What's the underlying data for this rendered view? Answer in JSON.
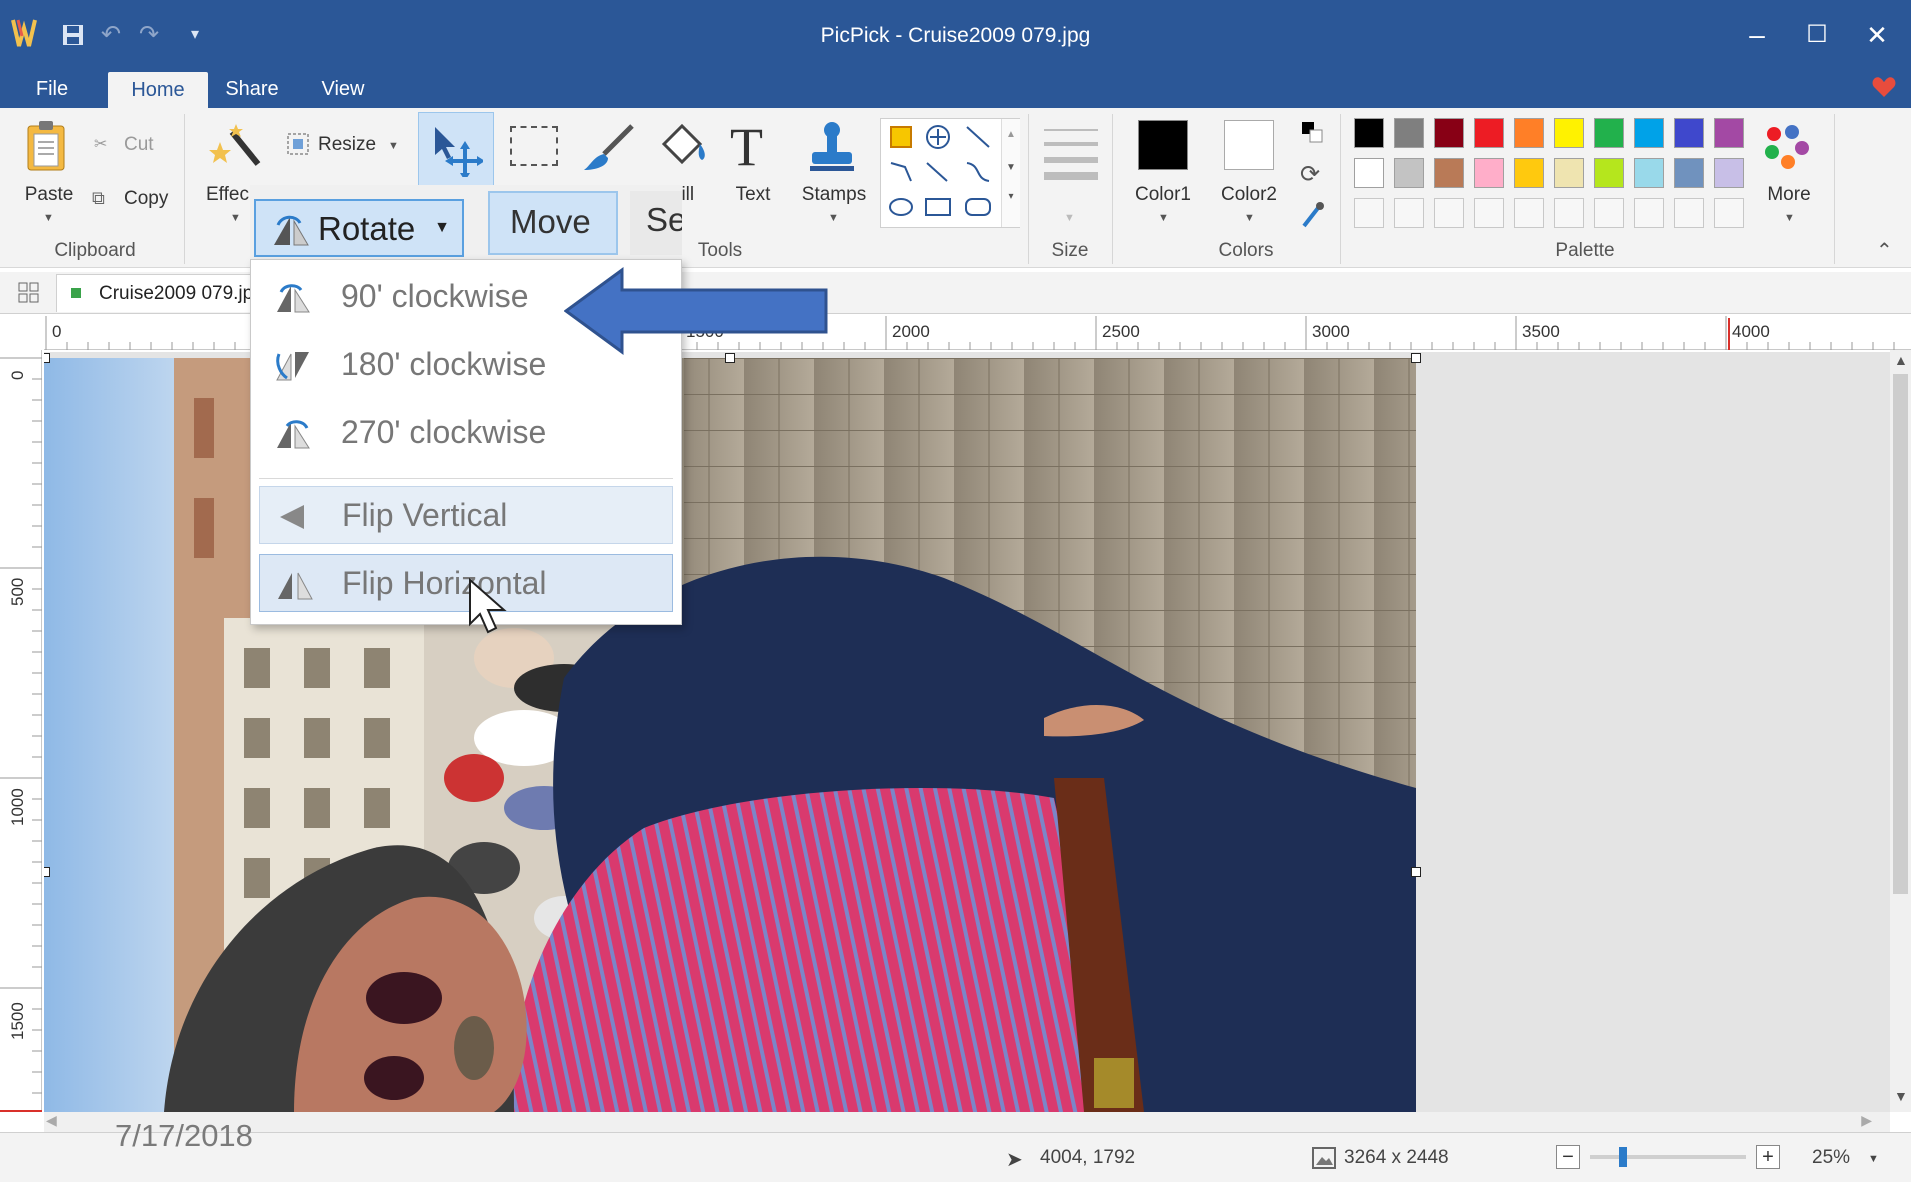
{
  "window": {
    "title": "PicPick - Cruise2009 079.jpg",
    "minimize_label": "–",
    "maximize_label": "☐",
    "close_label": "✕"
  },
  "menu_tabs": {
    "file": "File",
    "home": "Home",
    "share": "Share",
    "view": "View"
  },
  "ribbon": {
    "clipboard": {
      "paste": "Paste",
      "cut": "Cut",
      "copy": "Copy",
      "group_label": "Clipboard"
    },
    "image": {
      "effects": "Effec",
      "resize": "Resize"
    },
    "tools": {
      "fill": "Fill",
      "text": "Text",
      "stamps": "Stamps",
      "group_label": "Tools"
    },
    "size": {
      "group_label": "Size"
    },
    "colors": {
      "color1": "Color1",
      "color2": "Color2",
      "group_label": "Colors",
      "color1_value": "#000000",
      "color2_value": "#ffffff"
    },
    "palette": {
      "group_label": "Palette",
      "more": "More",
      "row1": [
        "#000000",
        "#7f7f7f",
        "#880015",
        "#ed1c24",
        "#ff7f27",
        "#fff200",
        "#22b14c",
        "#00a2e8",
        "#3f48cc",
        "#a349a4"
      ],
      "row2": [
        "#ffffff",
        "#c3c3c3",
        "#b97a57",
        "#ffaec9",
        "#ffc90e",
        "#efe4b0",
        "#b5e61d",
        "#99d9ea",
        "#7092be",
        "#c8bfe7"
      ]
    }
  },
  "document": {
    "tab_name": "Cruise2009 079.jp"
  },
  "ruler": {
    "h_labels": [
      "0",
      "1500",
      "2000",
      "2500",
      "3000",
      "3500",
      "4000"
    ],
    "v_labels": [
      "0",
      "500",
      "1000",
      "1500"
    ]
  },
  "dropdown": {
    "rotate_label": "Rotate",
    "move_label": "Move",
    "select_label": "Sel",
    "items": [
      "90' clockwise",
      "180' clockwise",
      "270' clockwise",
      "Flip Vertical",
      "Flip Horizontal"
    ]
  },
  "statusbar": {
    "cursor_pos": "4004, 1792",
    "image_size": "3264 x 2448",
    "zoom": "25%",
    "zoom_level": 0.25
  },
  "overlay": {
    "date_stamp": "7/17/2018"
  },
  "accent_color": "#2b5797"
}
